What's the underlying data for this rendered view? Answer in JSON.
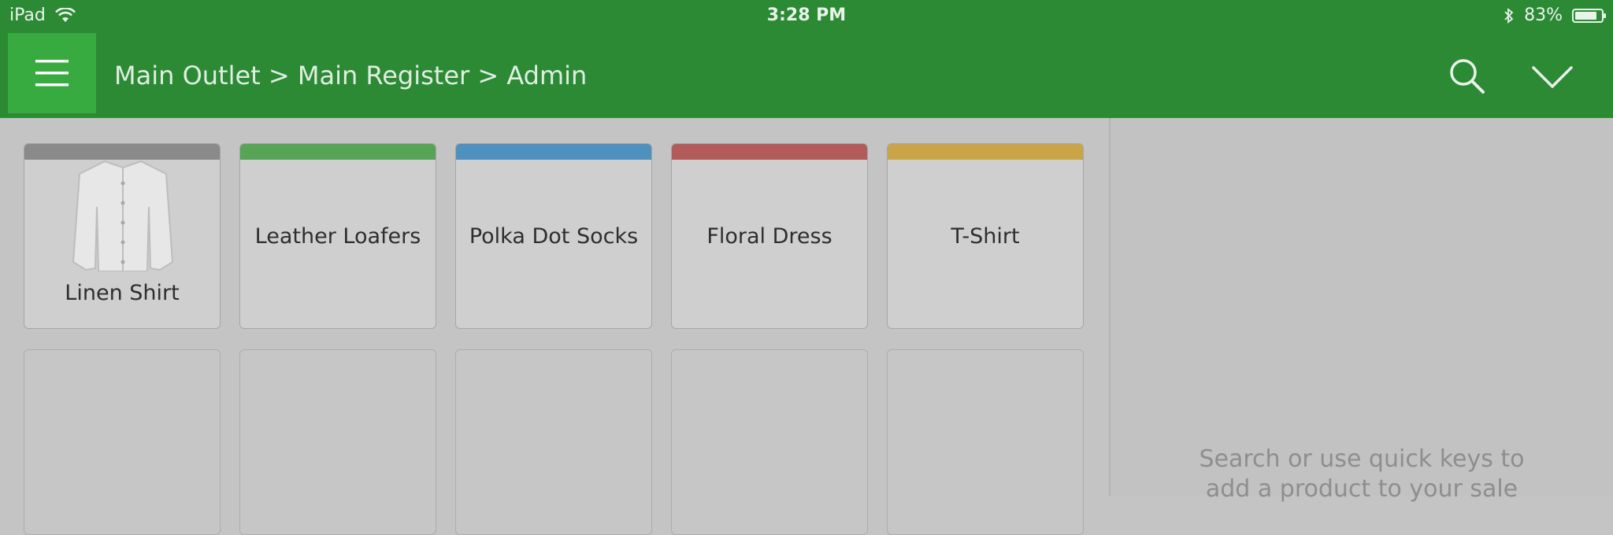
{
  "status_bar": {
    "device": "iPad",
    "time": "3:28 PM",
    "battery_percent_label": "83%",
    "battery_level": 0.83
  },
  "nav": {
    "breadcrumb": "Main Outlet > Main Register > Admin",
    "menu_icon": "hamburger-menu-icon",
    "search_icon": "search-icon",
    "collapse_icon": "chevron-down-icon"
  },
  "quick_keys": [
    {
      "label": "Linen Shirt",
      "color": "#8a8a8a",
      "has_image": true
    },
    {
      "label": "Leather Loafers",
      "color": "#57a457"
    },
    {
      "label": "Polka Dot Socks",
      "color": "#4e90be"
    },
    {
      "label": "Floral Dress",
      "color": "#b35a5a"
    },
    {
      "label": "T-Shirt",
      "color": "#c9a548"
    }
  ],
  "sale_panel": {
    "hint_line1": "Search or use quick keys to",
    "hint_line2": "add a product to your sale"
  },
  "colors": {
    "brand_green": "#2c8a35",
    "menu_button_green": "#37ab40"
  }
}
